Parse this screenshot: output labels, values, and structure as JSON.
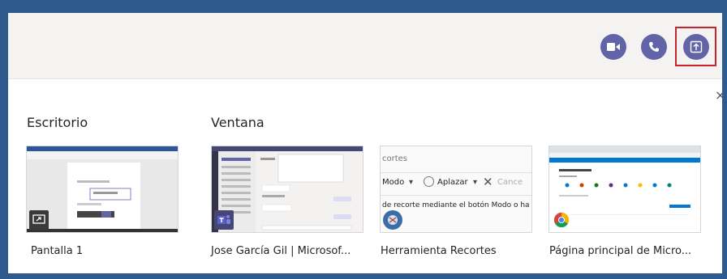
{
  "header": {
    "video_icon": "video-camera-icon",
    "call_icon": "phone-icon",
    "share_icon": "share-screen-icon",
    "accent": "#6264a7",
    "highlight": "#c4262e"
  },
  "dialog": {
    "close_glyph": "×",
    "desktop_heading": "Escritorio",
    "window_heading": "Ventana"
  },
  "tiles": [
    {
      "label": "Pantalla 1",
      "badge": "screen-share-icon"
    },
    {
      "label": "Jose García Gil | Microsof...",
      "badge": "teams-icon"
    },
    {
      "label": "Herramienta Recortes",
      "badge": "snipping-tool-icon",
      "preview_title": "cortes",
      "preview_mode": "Modo",
      "preview_delay": "Aplazar",
      "preview_cancel": "Cance",
      "preview_text": "de recorte mediante el botón Modo o ha"
    },
    {
      "label": "Página principal de Micro...",
      "badge": "chrome-icon"
    }
  ]
}
